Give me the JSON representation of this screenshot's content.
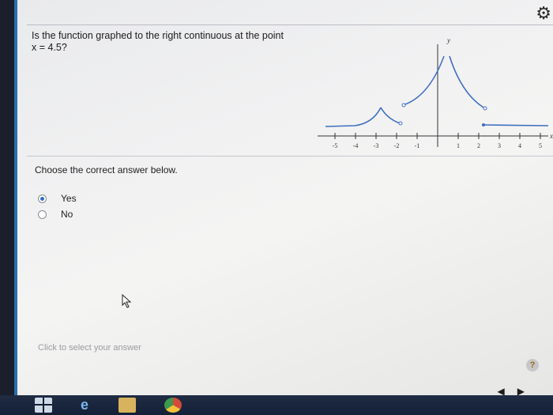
{
  "question": {
    "line1": "Is the function graphed to the right continuous at the point",
    "line2": "x = 4.5?"
  },
  "graph": {
    "x_axis_label": "x",
    "y_axis_label": "y",
    "x_ticks": [
      "-5",
      "-4",
      "-3",
      "-2",
      "-1",
      "1",
      "2",
      "3",
      "4",
      "5"
    ]
  },
  "answers": {
    "prompt": "Choose the correct answer below.",
    "options": [
      {
        "label": "Yes",
        "selected": true
      },
      {
        "label": "No",
        "selected": false
      }
    ]
  },
  "status": "Click to select your answer",
  "help": "?",
  "nav": {
    "prev": "◀",
    "next": "▶"
  },
  "icons": {
    "settings": "gear-icon",
    "cursor": "cursor-arrow-icon"
  }
}
